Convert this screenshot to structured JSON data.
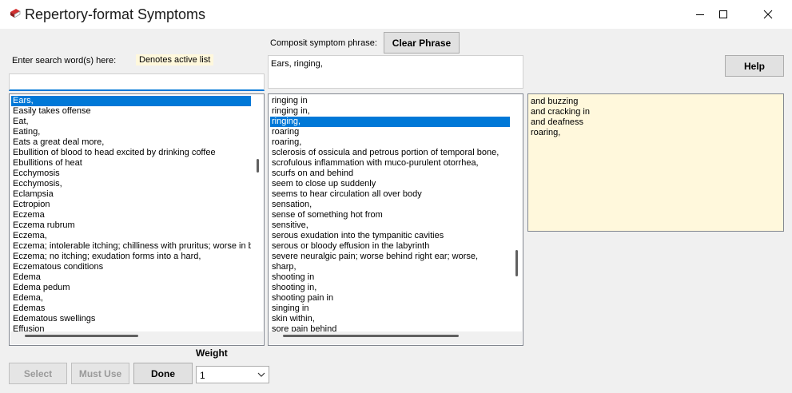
{
  "window": {
    "title": "Repertory-format Symptoms"
  },
  "labels": {
    "search_prompt": "Enter search word(s) here:",
    "active_list": "Denotes active list",
    "composite_phrase": "Composit symptom phrase:",
    "weight": "Weight"
  },
  "buttons": {
    "clear_phrase": "Clear Phrase",
    "help": "Help",
    "select": "Select",
    "must_use": "Must Use",
    "done": "Done"
  },
  "search": {
    "value": ""
  },
  "phrase": {
    "value": "Ears, ringing,"
  },
  "weight_select": {
    "value": "1"
  },
  "colors": {
    "selection": "#0078d7",
    "active_list": "#fff8dc",
    "focus_underline": "#0078d7"
  },
  "left_list": {
    "items": [
      "Ears,",
      "Easily takes offense",
      "Eat,",
      "Eating,",
      "Eats a great deal more,",
      "Ebullition of blood to head excited by drinking coffee",
      "Ebullitions of heat",
      "Ecchymosis",
      "Ecchymosis,",
      "Eclampsia",
      "Ectropion",
      "Eczema",
      "Eczema rubrum",
      "Eczema,",
      "Eczema; intolerable itching; chilliness with pruritus; worse in bed",
      "Eczema; no itching; exudation forms into a hard,",
      "Eczematous conditions",
      "Edema",
      "Edema pedum",
      "Edema,",
      "Edemas",
      "Edematous swellings",
      "Effusion"
    ],
    "selected_index": 0
  },
  "middle_list": {
    "items": [
      "ringing in",
      "ringing in,",
      "ringing,",
      "roaring",
      "roaring,",
      "sclerosis of ossicula and petrous portion of temporal bone,",
      "scrofulous inflammation with muco-purulent otorrhea,",
      "scurfs on and behind",
      "seem to close up suddenly",
      "seems to hear circulation all over body",
      "sensation,",
      "sense of something hot from",
      "sensitive,",
      "serous exudation into the tympanitic cavities",
      "serous or bloody effusion in the labyrinth",
      "severe neuralgic pain; worse behind right ear; worse,",
      "sharp,",
      "shooting in",
      "shooting in,",
      "shooting pain in",
      "singing in",
      "skin within,",
      "sore pain behind"
    ],
    "selected_index": 2
  },
  "right_list": {
    "items": [
      "and buzzing",
      "and cracking in",
      "and deafness",
      "roaring,"
    ]
  }
}
